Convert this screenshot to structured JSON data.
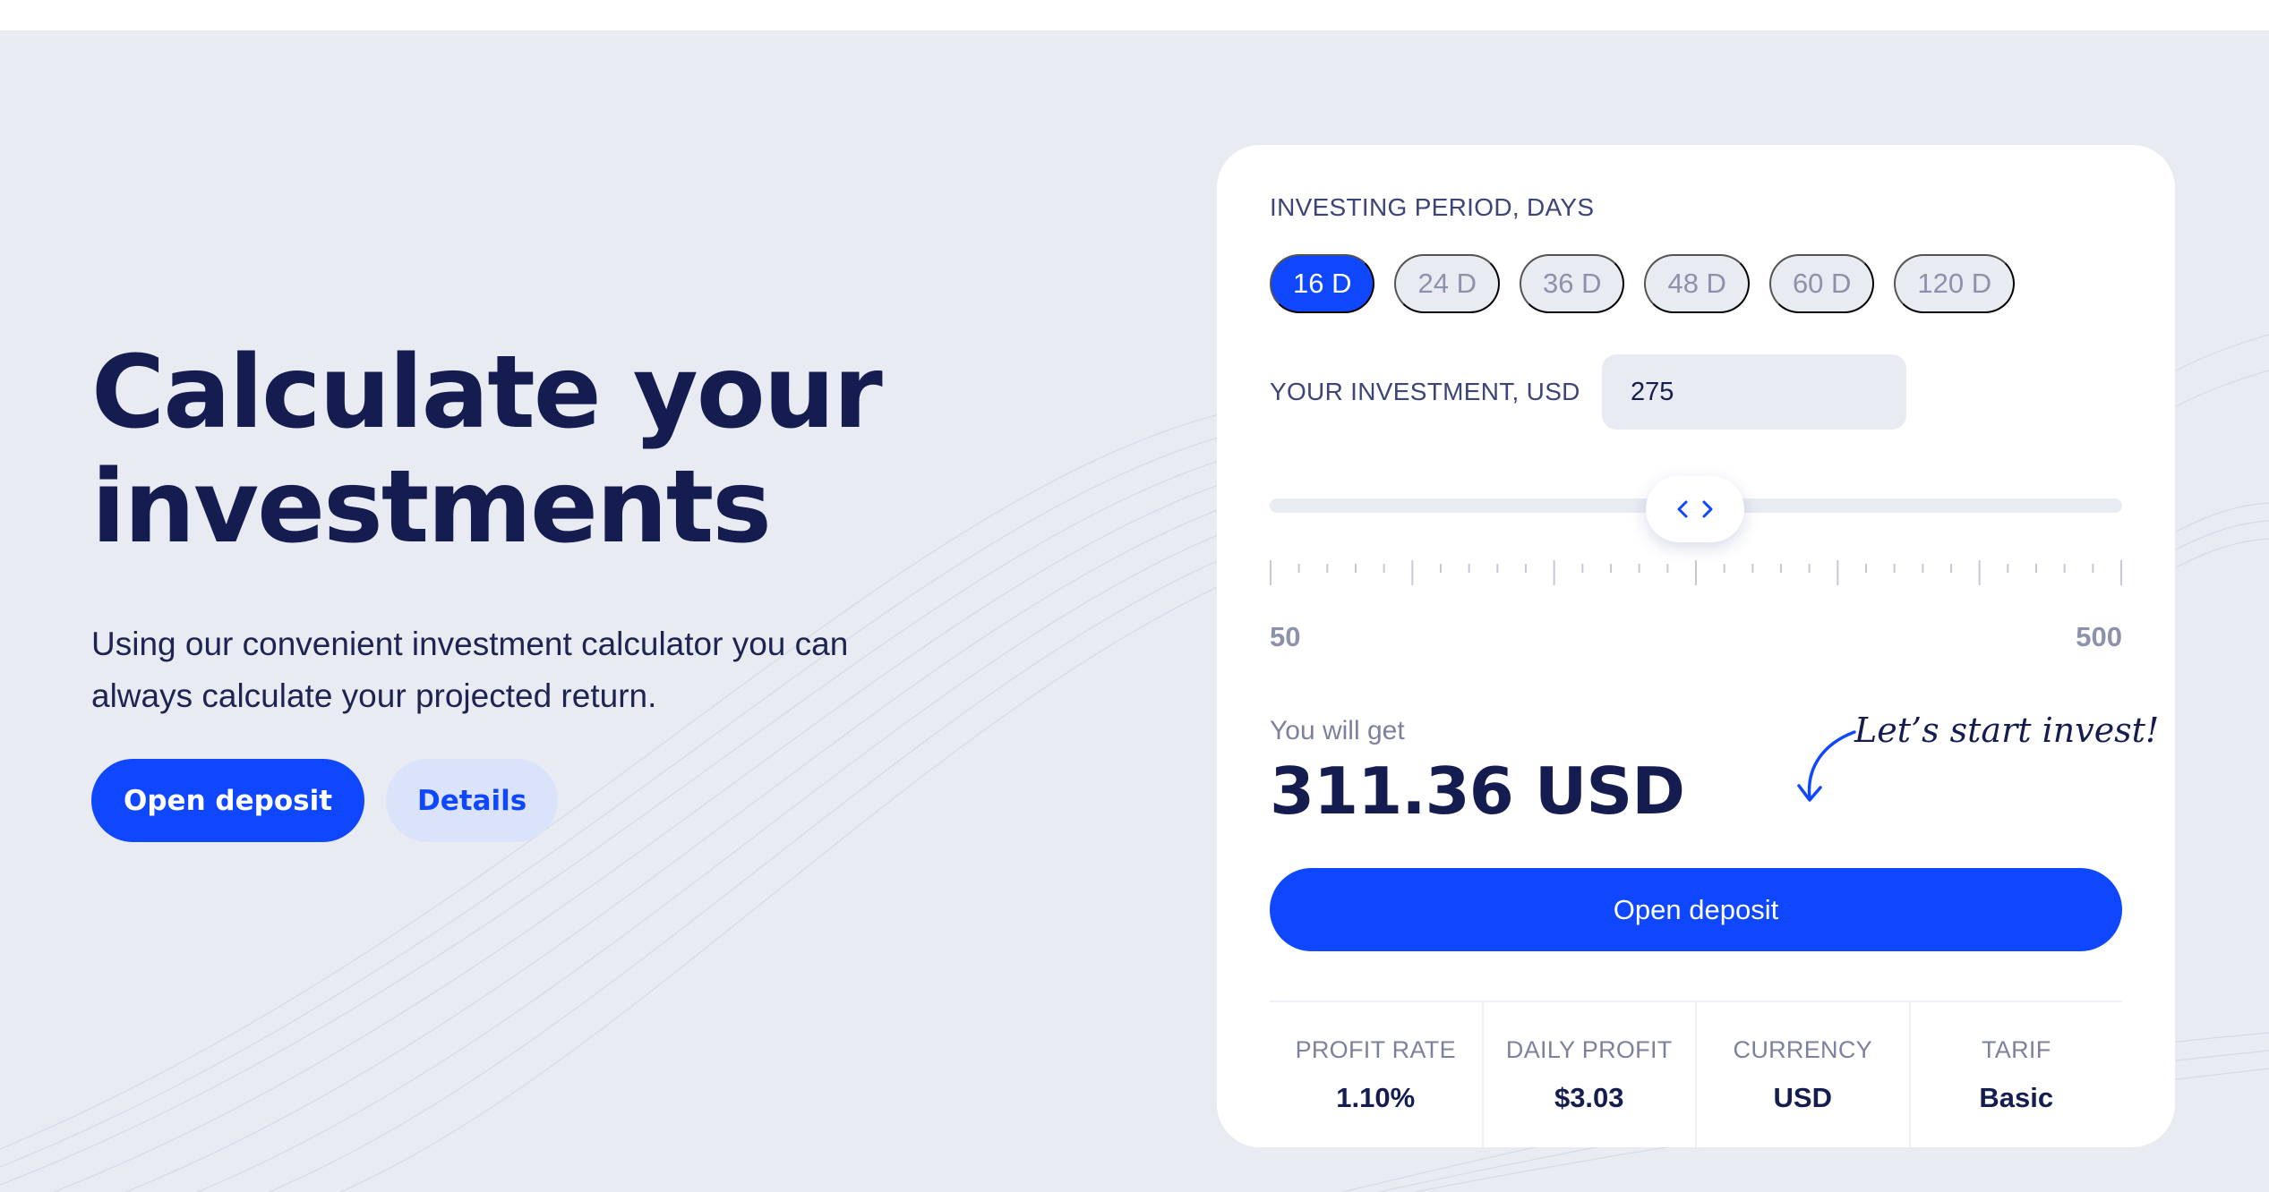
{
  "colors": {
    "accent": "#0f47ff",
    "heading": "#151c4f",
    "background": "#e9ebf2",
    "muted": "#8d92ab"
  },
  "hero": {
    "title_line1": "Calculate your",
    "title_line2": "investments",
    "description_line1": "Using our convenient investment calculator you can",
    "description_line2": "always calculate your projected return.",
    "primary_button": "Open deposit",
    "secondary_button": "Details"
  },
  "calculator": {
    "period_label": "INVESTING PERIOD, DAYS",
    "periods": [
      "16 D",
      "24 D",
      "36 D",
      "48 D",
      "60 D",
      "120 D"
    ],
    "selected_period": "16 D",
    "investment_label": "YOUR INVESTMENT, USD",
    "investment_value": "275",
    "slider": {
      "min": "50",
      "max": "500",
      "value": 275,
      "thumb_icons": [
        "chevron-left-icon",
        "chevron-right-icon"
      ]
    },
    "result_label": "You will get",
    "result_value": "311.36 USD",
    "cta_note": "Let’s start invest!",
    "cta_button": "Open deposit",
    "stats": [
      {
        "label": "PROFIT RATE",
        "value": "1.10%"
      },
      {
        "label": "DAILY PROFIT",
        "value": "$3.03"
      },
      {
        "label": "CURRENCY",
        "value": "USD"
      },
      {
        "label": "TARIF",
        "value": "Basic"
      }
    ]
  }
}
